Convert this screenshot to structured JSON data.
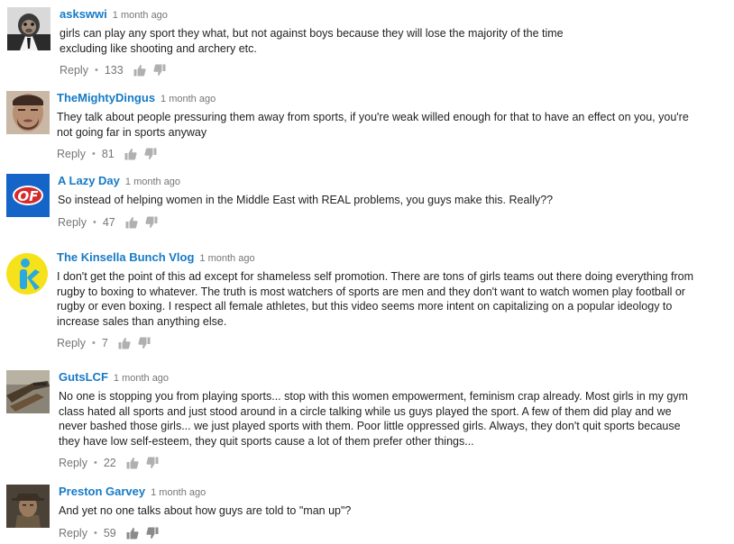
{
  "comments": [
    {
      "author": "askswwi",
      "time": "1 month ago",
      "text": "girls can play any sport they what, but not against boys because they will lose the majority of the time excluding like shooting and archery etc.",
      "reply_label": "Reply",
      "separator": "•",
      "likes": "133",
      "avatar_icon": "monkey-avatar-icon"
    },
    {
      "author": "TheMightyDingus",
      "time": "1 month ago",
      "text": "They talk about people pressuring them away from sports, if you're weak willed enough for that to have an effect on you, you're not going far in sports anyway",
      "reply_label": "Reply",
      "separator": "•",
      "likes": "81",
      "avatar_icon": "face-photo-avatar-icon"
    },
    {
      "author": "A Lazy Day",
      "time": "1 month ago",
      "text": "So instead of helping women in the Middle East with REAL problems, you guys make this. Really??",
      "reply_label": "Reply",
      "separator": "•",
      "likes": "47",
      "avatar_icon": "of-logo-avatar-icon"
    },
    {
      "author": "The Kinsella Bunch Vlog",
      "time": "1 month ago",
      "text": "I don't get the point of this ad except for shameless self promotion. There are tons of girls teams out there doing everything from rugby to boxing to whatever. The truth is most watchers of sports are men and they don't want to watch women play football or rugby or even boxing. I respect all female athletes, but this video seems more intent on capitalizing on a popular ideology to increase sales than anything else.",
      "reply_label": "Reply",
      "separator": "•",
      "likes": "7",
      "avatar_icon": "k-logo-avatar-icon"
    },
    {
      "author": "GutsLCF",
      "time": "1 month ago",
      "text": "No one is stopping you from playing sports... stop with this women empowerment, feminism crap already. Most girls in my gym class hated all sports and just stood around in a circle talking while us guys played the sport. A few of them did play and we never bashed those girls... we just played sports with them. Poor little oppressed girls. Always, they don't quit sports because they have low self-esteem, they quit sports cause a lot of them prefer other things...",
      "reply_label": "Reply",
      "separator": "•",
      "likes": "22",
      "avatar_icon": "weapon-photo-avatar-icon"
    },
    {
      "author": "Preston Garvey",
      "time": "1 month ago",
      "text": "And yet no one talks about how guys are told to \"man up\"?",
      "reply_label": "Reply",
      "separator": "•",
      "likes": "59",
      "avatar_icon": "game-character-avatar-icon"
    }
  ],
  "colors": {
    "author": "#167ac6",
    "meta": "#767676",
    "text": "#222222",
    "thumb": "#b0b0b0"
  }
}
